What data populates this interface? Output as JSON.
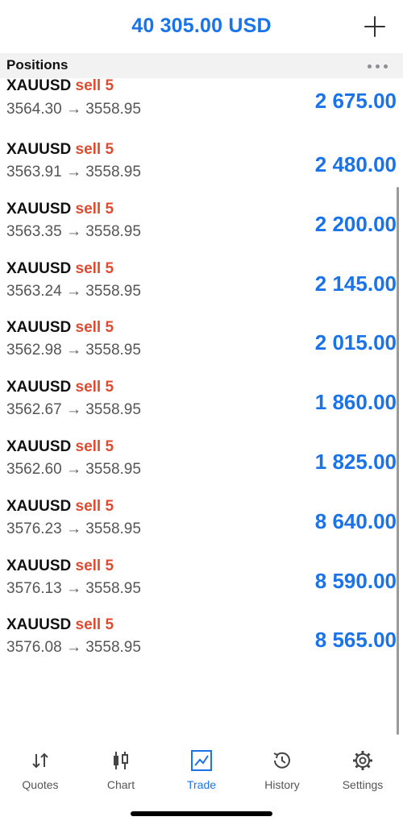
{
  "header": {
    "balance": "40 305.00 USD",
    "add_icon": "plus-icon"
  },
  "section": {
    "title": "Positions",
    "more_icon": "more-horizontal-icon"
  },
  "positions": [
    {
      "symbol": "XAUUSD",
      "side": "sell 5",
      "prices": "3564.30 → 3558.95",
      "profit": "2 675.00"
    },
    {
      "symbol": "XAUUSD",
      "side": "sell 5",
      "prices": "3563.91 → 3558.95",
      "profit": "2 480.00"
    },
    {
      "symbol": "XAUUSD",
      "side": "sell 5",
      "prices": "3563.35 → 3558.95",
      "profit": "2 200.00"
    },
    {
      "symbol": "XAUUSD",
      "side": "sell 5",
      "prices": "3563.24 → 3558.95",
      "profit": "2 145.00"
    },
    {
      "symbol": "XAUUSD",
      "side": "sell 5",
      "prices": "3562.98 → 3558.95",
      "profit": "2 015.00"
    },
    {
      "symbol": "XAUUSD",
      "side": "sell 5",
      "prices": "3562.67 → 3558.95",
      "profit": "1 860.00"
    },
    {
      "symbol": "XAUUSD",
      "side": "sell 5",
      "prices": "3562.60 → 3558.95",
      "profit": "1 825.00"
    },
    {
      "symbol": "XAUUSD",
      "side": "sell 5",
      "prices": "3576.23 → 3558.95",
      "profit": "8 640.00"
    },
    {
      "symbol": "XAUUSD",
      "side": "sell 5",
      "prices": "3576.13 → 3558.95",
      "profit": "8 590.00"
    },
    {
      "symbol": "XAUUSD",
      "side": "sell 5",
      "prices": "3576.08 → 3558.95",
      "profit": "8 565.00"
    }
  ],
  "tabs": [
    {
      "label": "Quotes",
      "icon": "quotes-arrows-icon",
      "active": false
    },
    {
      "label": "Chart",
      "icon": "candlestick-chart-icon",
      "active": false
    },
    {
      "label": "Trade",
      "icon": "trade-chart-icon",
      "active": true
    },
    {
      "label": "History",
      "icon": "history-clock-icon",
      "active": false
    },
    {
      "label": "Settings",
      "icon": "gear-icon",
      "active": false
    }
  ],
  "colors": {
    "accent": "#1a73e8",
    "sell": "#e04a2f",
    "text": "#111111",
    "muted": "#555555"
  }
}
